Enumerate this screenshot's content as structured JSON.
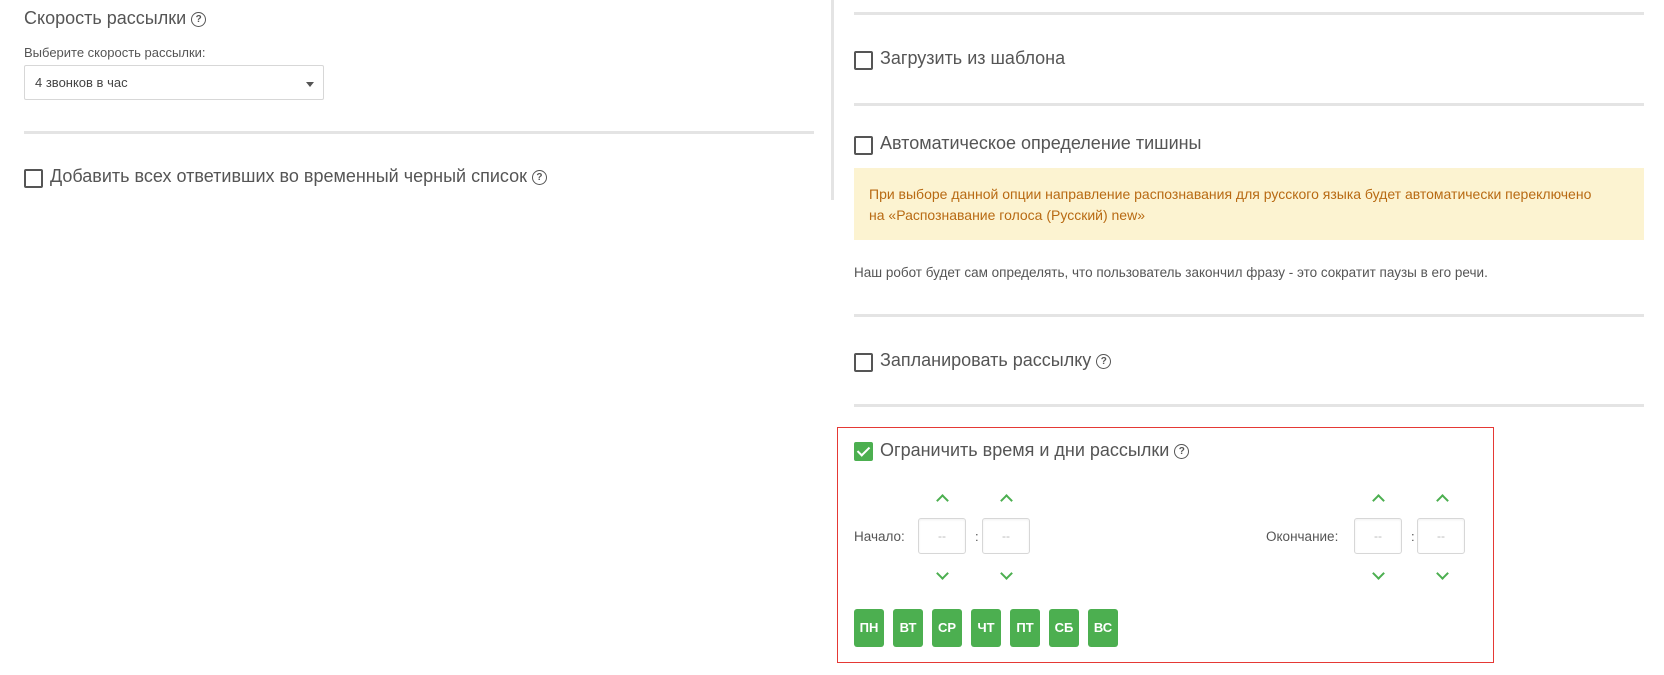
{
  "speed": {
    "title": "Скорость рассылки",
    "select_label": "Выберите скорость рассылки:",
    "select_value": "4 звонков в час"
  },
  "blacklist": {
    "label": "Добавить всех ответивших во временный черный список",
    "checked": false
  },
  "template": {
    "label": "Загрузить из шаблона",
    "checked": false
  },
  "silence": {
    "label": "Автоматическое определение тишины",
    "checked": false,
    "alert_line1": "При выборе данной опции направление распознавания для русского языка будет автоматически переключено",
    "alert_line2": "на «Распознавание голоса (Русский) new»",
    "note": "Наш робот будет сам определять, что пользователь закончил фразу - это сократит паузы в его речи."
  },
  "schedule": {
    "label": "Запланировать рассылку",
    "checked": false
  },
  "limit": {
    "label": "Ограничить время и дни рассылки",
    "checked": true,
    "start_label": "Начало:",
    "end_label": "Окончание:",
    "start_hours": "--",
    "start_minutes": "--",
    "end_hours": "--",
    "end_minutes": "--",
    "separator": ":",
    "days": [
      "ПН",
      "ВТ",
      "СР",
      "ЧТ",
      "ПТ",
      "СБ",
      "ВС"
    ]
  },
  "help_glyph": "?",
  "colors": {
    "accent": "#4caf50",
    "alert_bg": "#fcf3d1",
    "alert_text": "#b86a13",
    "highlight": "#e53935"
  }
}
